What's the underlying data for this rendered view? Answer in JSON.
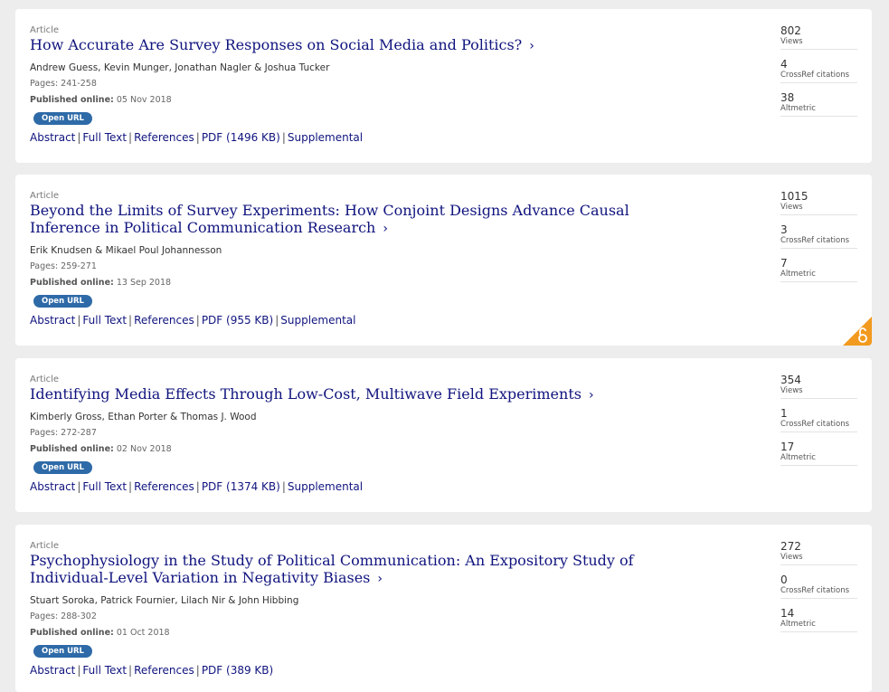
{
  "articles": [
    {
      "type": "Article",
      "title": "How Accurate Are Survey Responses on Social Media and Politics?",
      "authors": "Andrew Guess, Kevin Munger, Jonathan Nagler & Joshua Tucker",
      "pages": "Pages: 241-258",
      "published_label": "Published online:",
      "published_date": "05 Nov 2018",
      "badge": "Open URL",
      "links": [
        "Abstract",
        "Full Text",
        "References",
        "PDF (1496 KB)",
        "Supplemental"
      ],
      "metrics": [
        {
          "value": "802",
          "label": "Views"
        },
        {
          "value": "4",
          "label": "CrossRef citations"
        },
        {
          "value": "38",
          "label": "Altmetric"
        }
      ],
      "open_access": false
    },
    {
      "type": "Article",
      "title": "Beyond the Limits of Survey Experiments: How Conjoint Designs Advance Causal Inference in Political Communication Research",
      "authors": "Erik Knudsen & Mikael Poul Johannesson",
      "pages": "Pages: 259-271",
      "published_label": "Published online:",
      "published_date": "13 Sep 2018",
      "badge": "Open URL",
      "links": [
        "Abstract",
        "Full Text",
        "References",
        "PDF (955 KB)",
        "Supplemental"
      ],
      "metrics": [
        {
          "value": "1015",
          "label": "Views"
        },
        {
          "value": "3",
          "label": "CrossRef citations"
        },
        {
          "value": "7",
          "label": "Altmetric"
        }
      ],
      "open_access": true
    },
    {
      "type": "Article",
      "title": "Identifying Media Effects Through Low-Cost, Multiwave Field Experiments",
      "authors": "Kimberly Gross, Ethan Porter & Thomas J. Wood",
      "pages": "Pages: 272-287",
      "published_label": "Published online:",
      "published_date": "02 Nov 2018",
      "badge": "Open URL",
      "links": [
        "Abstract",
        "Full Text",
        "References",
        "PDF (1374 KB)",
        "Supplemental"
      ],
      "metrics": [
        {
          "value": "354",
          "label": "Views"
        },
        {
          "value": "1",
          "label": "CrossRef citations"
        },
        {
          "value": "17",
          "label": "Altmetric"
        }
      ],
      "open_access": false
    },
    {
      "type": "Article",
      "title": "Psychophysiology in the Study of Political Communication: An Expository Study of Individual-Level Variation in Negativity Biases",
      "authors": "Stuart Soroka, Patrick Fournier, Lilach Nir & John Hibbing",
      "pages": "Pages: 288-302",
      "published_label": "Published online:",
      "published_date": "01 Oct 2018",
      "badge": "Open URL",
      "links": [
        "Abstract",
        "Full Text",
        "References",
        "PDF (389 KB)"
      ],
      "metrics": [
        {
          "value": "272",
          "label": "Views"
        },
        {
          "value": "0",
          "label": "CrossRef citations"
        },
        {
          "value": "14",
          "label": "Altmetric"
        }
      ],
      "open_access": false
    }
  ],
  "colors": {
    "title": "#10147e",
    "badge": "#2e6aa7",
    "open_access": "#f29a1f"
  }
}
